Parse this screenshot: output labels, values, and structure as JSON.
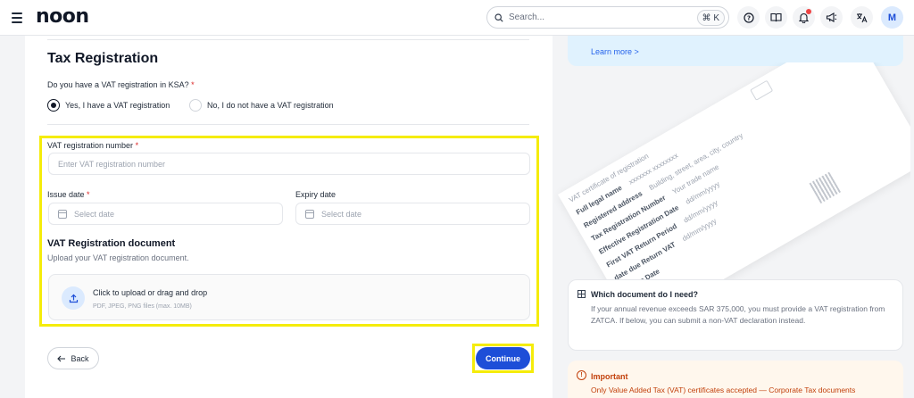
{
  "header": {
    "logo": "noon",
    "search": {
      "placeholder": "Search...",
      "shortcut": "⌘ K"
    },
    "avatar_initial": "M"
  },
  "form": {
    "title": "Tax Registration",
    "question": "Do you have a VAT registration in KSA?",
    "radio_yes": "Yes, I have a VAT registration",
    "radio_no": "No, I do not have a VAT registration",
    "selected": "yes",
    "vat_number_label": "VAT registration number",
    "vat_number_placeholder": "Enter VAT registration number",
    "issue_date_label": "Issue date",
    "issue_date_placeholder": "Select date",
    "expiry_date_label": "Expiry date",
    "expiry_date_placeholder": "Select date",
    "document_title": "VAT Registration document",
    "document_subtitle": "Upload your VAT registration document.",
    "upload_main": "Click to upload or drag and drop",
    "upload_sub": "PDF, JPEG, PNG files (max. 10MB)",
    "back_label": "Back",
    "continue_label": "Continue"
  },
  "right": {
    "learn_more": "Learn more >",
    "certificate": {
      "heading": "VAT certificate of registration",
      "rows": [
        {
          "label": "Full legal name",
          "value": "xxxxxxx xxxxxxxx"
        },
        {
          "label": "Registered address",
          "value": "Building, street, area, city, country"
        },
        {
          "label": "Tax Registration Number",
          "value": "Your trade name"
        },
        {
          "label": "Effective Registration Date",
          "value": "dd/mm/yyyy"
        },
        {
          "label": "First VAT Return Period",
          "value": "dd/mm/yyyy"
        },
        {
          "label": "date due Return VAT",
          "value": "dd/mm/yyyy"
        },
        {
          "label": "Issuing Date",
          "value": ""
        }
      ]
    },
    "which_title": "Which document do I need?",
    "which_text": "If your annual revenue exceeds SAR 375,000, you must provide a VAT registration from ZATCA. If below, you can submit a non-VAT declaration instead.",
    "important_title": "Important",
    "important_text": "Only Value Added Tax (VAT) certificates accepted — Corporate Tax documents"
  },
  "colors": {
    "accent": "#1d4ed8",
    "highlight": "#f5ec0a",
    "warning": "#c2410c"
  }
}
